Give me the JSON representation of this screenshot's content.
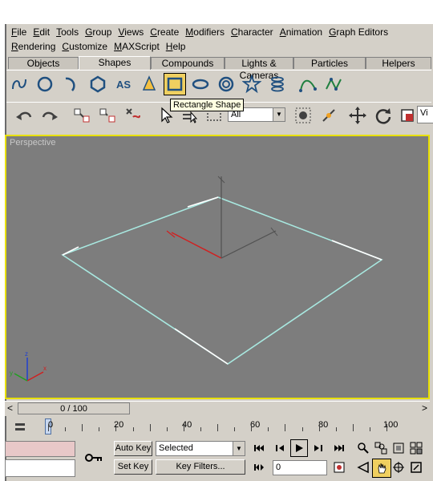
{
  "menu": {
    "row1": [
      "File",
      "Edit",
      "Tools",
      "Group",
      "Views",
      "Create",
      "Modifiers",
      "Character",
      "Animation",
      "Graph Editors"
    ],
    "row2": [
      "Rendering",
      "Customize",
      "MAXScript",
      "Help"
    ]
  },
  "tabs": [
    {
      "label": "Objects",
      "active": false
    },
    {
      "label": "Shapes",
      "active": true
    },
    {
      "label": "Compounds",
      "active": false
    },
    {
      "label": "Lights & Cameras",
      "active": false
    },
    {
      "label": "Particles",
      "active": false
    },
    {
      "label": "Helpers",
      "active": false
    }
  ],
  "shapes_toolbar": {
    "tooltip": "Rectangle Shape",
    "icons": [
      "line-icon",
      "circle-icon",
      "arc-icon",
      "ngon-icon",
      "text-icon",
      "cone-icon",
      "rectangle-icon",
      "ellipse-icon",
      "donut-icon",
      "star-icon",
      "helix-icon",
      "spline-icon-1",
      "spline-icon-2"
    ]
  },
  "main_toolbar": {
    "selection_filter": "All",
    "truncated_field": "Vi"
  },
  "viewport": {
    "label": "Perspective"
  },
  "time_slider": {
    "frame_display": "0 / 100",
    "prev": "<",
    "next": ">"
  },
  "track": {
    "labels": [
      "0",
      "20",
      "40",
      "60",
      "80",
      "100"
    ]
  },
  "bottom": {
    "auto_key": "Auto Key",
    "set_key": "Set Key",
    "selected": "Selected",
    "key_filters": "Key Filters...",
    "current_frame": "0"
  }
}
